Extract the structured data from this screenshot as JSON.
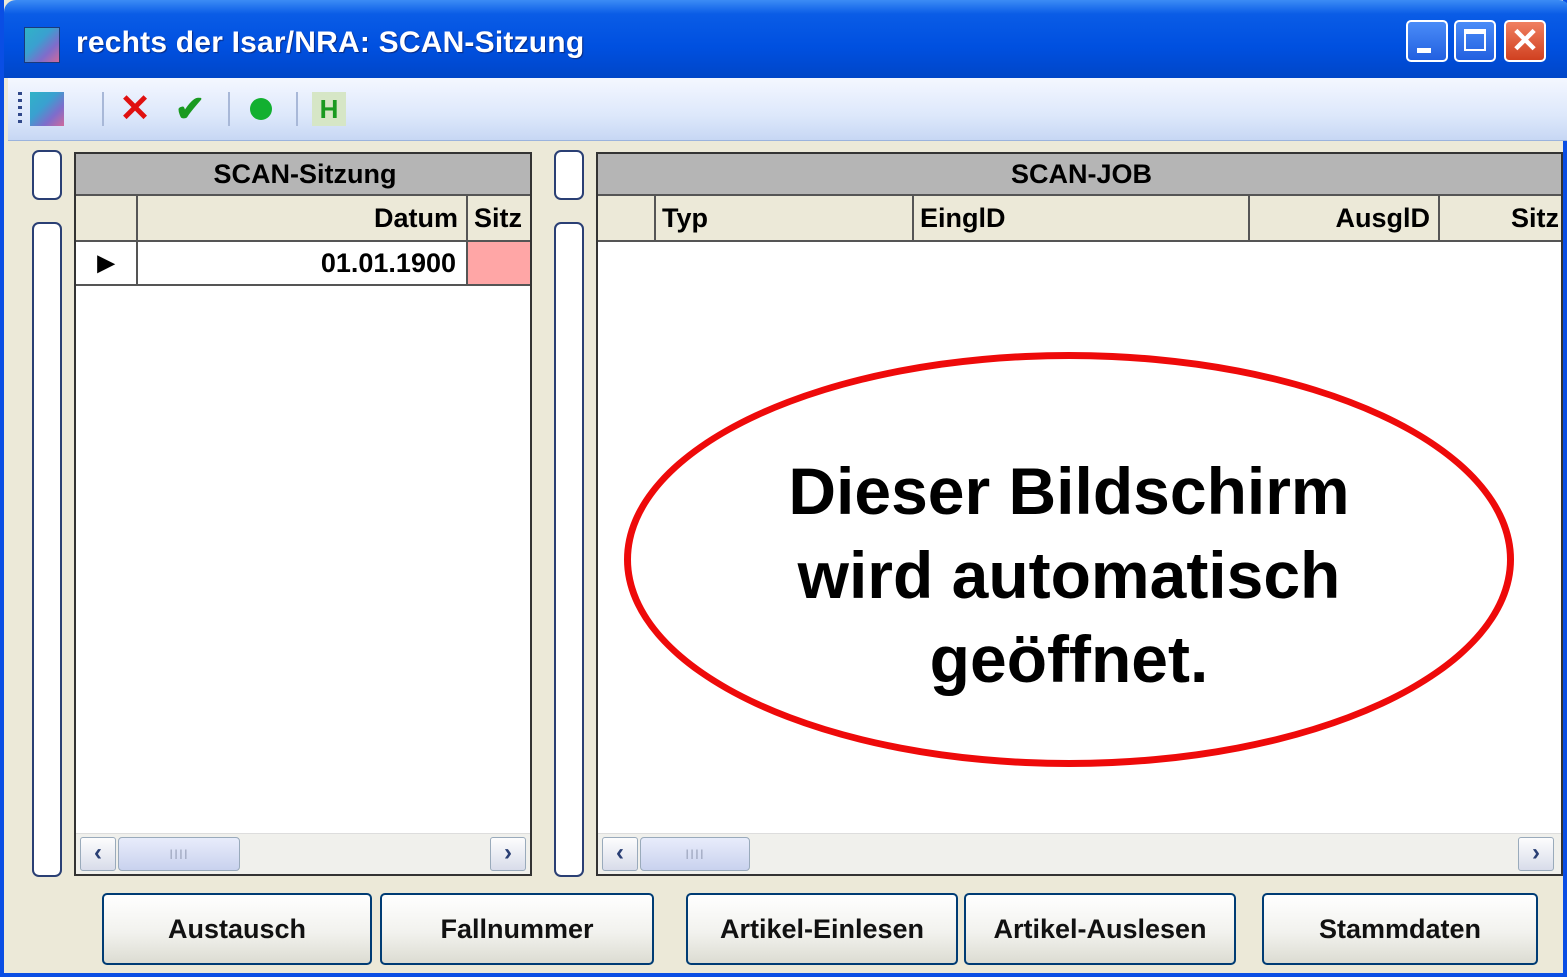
{
  "window": {
    "title": "rechts der Isar/NRA: SCAN-Sitzung",
    "controls": {
      "close_glyph": "✕"
    }
  },
  "toolbar": {
    "cancel_glyph": "✕",
    "ok_glyph": "✔",
    "help_label": "H"
  },
  "left_grid": {
    "caption": "SCAN-Sitzung",
    "columns": [
      "Datum",
      "Sitz"
    ],
    "rows": [
      {
        "Datum": "01.01.1900",
        "Sitz": ""
      }
    ],
    "selected_row_marker": "▶"
  },
  "right_grid": {
    "caption": "SCAN-JOB",
    "columns": [
      "Typ",
      "EinglD",
      "AusglD",
      "Sitz"
    ],
    "rows": []
  },
  "scroll": {
    "left_arrow": "‹",
    "right_arrow": "›",
    "thumb_grip": "IIII"
  },
  "buttons": {
    "austausch": "Austausch",
    "fallnummer": "Fallnummer",
    "artikel_einlesen": "Artikel-Einlesen",
    "artikel_auslesen": "Artikel-Auslesen",
    "stammdaten": "Stammdaten"
  },
  "callout": {
    "line1": "Dieser Bildschirm",
    "line2": "wird automatisch",
    "line3": "geöffnet."
  },
  "colors": {
    "titlebar": "#0050e0",
    "callout_border": "#ee0a0a",
    "cell_highlight": "#ffa6a6"
  }
}
